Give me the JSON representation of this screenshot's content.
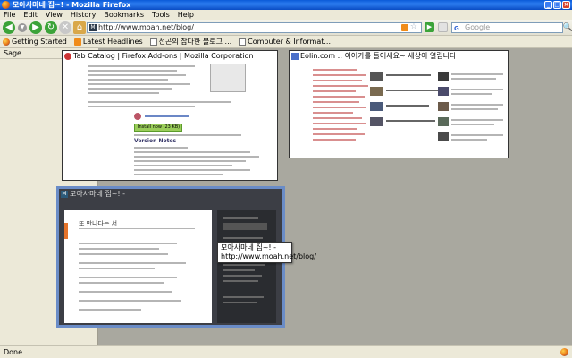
{
  "window": {
    "title": "모아사마네 집~! - Mozilla Firefox"
  },
  "menu": [
    "File",
    "Edit",
    "View",
    "History",
    "Bookmarks",
    "Tools",
    "Help"
  ],
  "navigation": {
    "url": "http://www.moah.net/blog/",
    "search_placeholder": "Google"
  },
  "bookmarks": [
    {
      "label": "Getting Started",
      "icon": "firefox-icon"
    },
    {
      "label": "Latest Headlines",
      "icon": "rss-icon"
    },
    {
      "label": "선곤의 잡다한 블로그 ...",
      "icon": "page-icon"
    },
    {
      "label": "Computer & Informat...",
      "icon": "page-icon"
    }
  ],
  "sidebar": {
    "title": "Sage"
  },
  "previews": [
    {
      "title": "Tab Catalog | Firefox Add-ons | Mozilla Corporation",
      "button": "Install now (23 KB)",
      "heading": "Version Notes"
    },
    {
      "title": "Eolin.com :: 이어가를 들어세요~ 세상이 열립니다"
    },
    {
      "title": "모아사마네 집~! -",
      "content_heading": "또 만나다는 서"
    }
  ],
  "tooltip": {
    "title": "모아사마네 집~! -",
    "url": "http://www.moah.net/blog/"
  },
  "status": {
    "text": "Done"
  },
  "colors": {
    "titlebar": "#0a5ad8",
    "chrome": "#ece9d8",
    "background": "#a9a89f",
    "selected_border": "#6a8cc7"
  }
}
